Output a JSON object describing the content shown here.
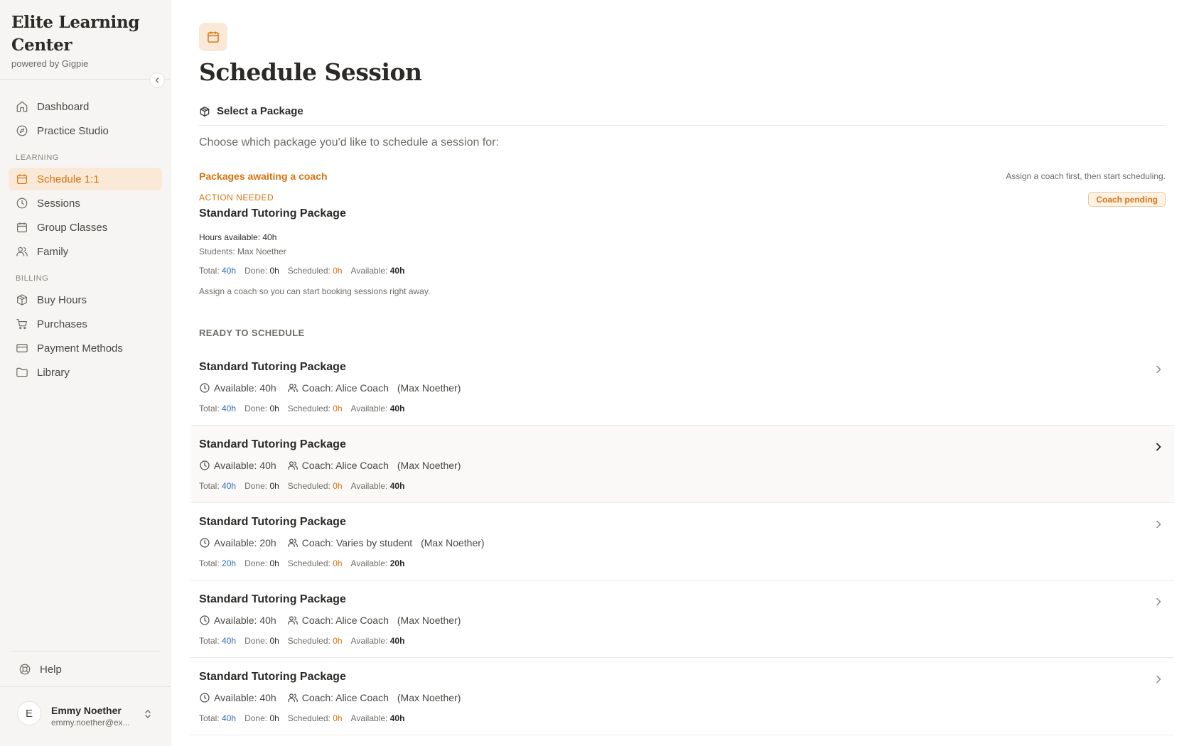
{
  "brand": {
    "title": "Elite Learning Center",
    "subtitle": "powered by Gigpie"
  },
  "nav": {
    "dashboard": "Dashboard",
    "practice": "Practice Studio",
    "section_learning": "LEARNING",
    "schedule": "Schedule 1:1",
    "sessions": "Sessions",
    "group_classes": "Group Classes",
    "family": "Family",
    "section_billing": "BILLING",
    "buy_hours": "Buy Hours",
    "purchases": "Purchases",
    "payment_methods": "Payment Methods",
    "library": "Library",
    "help": "Help"
  },
  "user": {
    "initial": "E",
    "name": "Emmy Noether",
    "email": "emmy.noether@ex..."
  },
  "page": {
    "title": "Schedule Session",
    "step": "Select a Package",
    "intro": "Choose which package you'd like to schedule a session for:"
  },
  "awaiting": {
    "title": "Packages awaiting a coach",
    "hint": "Assign a coach first, then start scheduling.",
    "action": "ACTION NEEDED",
    "badge": "Coach pending",
    "package": {
      "name": "Standard Tutoring Package",
      "hours": "Hours available: 40h",
      "students": "Students: Max Noether",
      "total": "40h",
      "done": "0h",
      "scheduled": "0h",
      "available": "40h"
    },
    "note": "Assign a coach so you can start booking sessions right away."
  },
  "labels": {
    "total": "Total:",
    "done": "Done:",
    "scheduled": "Scheduled:",
    "available": "Available:"
  },
  "ready": {
    "label": "READY TO SCHEDULE",
    "packages": [
      {
        "name": "Standard Tutoring Package",
        "available": "Available: 40h",
        "coach": "Coach: Alice Coach",
        "student": "(Max Noether)",
        "total": "40h",
        "done": "0h",
        "scheduled": "0h",
        "avail": "40h"
      },
      {
        "name": "Standard Tutoring Package",
        "available": "Available: 40h",
        "coach": "Coach: Alice Coach",
        "student": "(Max Noether)",
        "total": "40h",
        "done": "0h",
        "scheduled": "0h",
        "avail": "40h"
      },
      {
        "name": "Standard Tutoring Package",
        "available": "Available: 20h",
        "coach": "Coach: Varies by student",
        "student": "(Max Noether)",
        "total": "20h",
        "done": "0h",
        "scheduled": "0h",
        "avail": "20h"
      },
      {
        "name": "Standard Tutoring Package",
        "available": "Available: 40h",
        "coach": "Coach: Alice Coach",
        "student": "(Max Noether)",
        "total": "40h",
        "done": "0h",
        "scheduled": "0h",
        "avail": "40h"
      },
      {
        "name": "Standard Tutoring Package",
        "available": "Available: 40h",
        "coach": "Coach: Alice Coach",
        "student": "(Max Noether)",
        "total": "40h",
        "done": "0h",
        "scheduled": "0h",
        "avail": "40h"
      }
    ]
  },
  "colors": {
    "accent": "#d9730d",
    "accent_bg": "#fbe9d8",
    "total_blue": "#2f6db5",
    "sidebar_bg": "#f6f5f3"
  }
}
